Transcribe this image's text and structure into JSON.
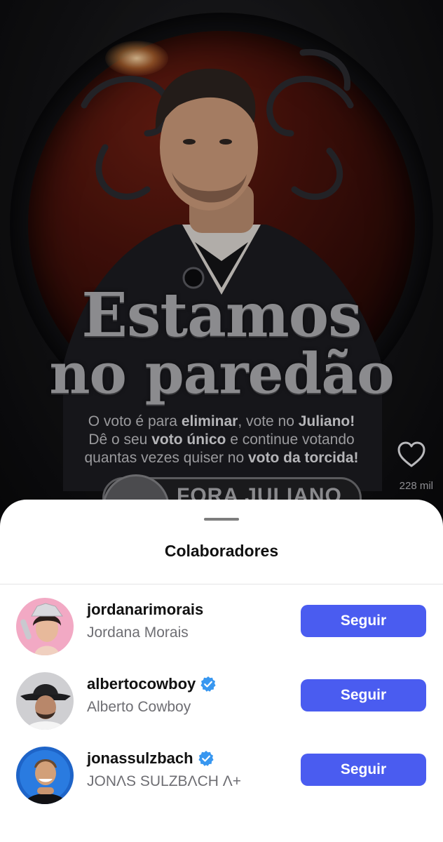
{
  "post": {
    "headline_line1": "Estamos",
    "headline_line2": "no paredão",
    "body_line1_a": "O voto é para ",
    "body_line1_b": "eliminar",
    "body_line1_c": ", vote no ",
    "body_line1_d": "Juliano!",
    "body_line2_a": "Dê o seu ",
    "body_line2_b": "voto único",
    "body_line2_c": " e continue votando",
    "body_line3_a": "quantas vezes quiser no ",
    "body_line3_b": "voto da torcida!",
    "stamp_text": "FORA JULIANO",
    "like_count": "228 mil"
  },
  "sheet": {
    "title": "Colaboradores",
    "collaborators": [
      {
        "username": "jordanarimorais",
        "fullname": "Jordana Morais",
        "verified": false,
        "button_label": "Seguir"
      },
      {
        "username": "albertocowboy",
        "fullname": "Alberto Cowboy",
        "verified": true,
        "button_label": "Seguir"
      },
      {
        "username": "jonassulzbach",
        "fullname": "JONΛS SULZBΛCH Λ+",
        "verified": true,
        "button_label": "Seguir"
      }
    ]
  },
  "colors": {
    "follow_button": "#4a5cf0",
    "verified_badge": "#3897f0",
    "sheet_background": "#ffffff"
  },
  "icons": {
    "like": "heart-outline-icon",
    "verified": "verified-badge-icon"
  }
}
